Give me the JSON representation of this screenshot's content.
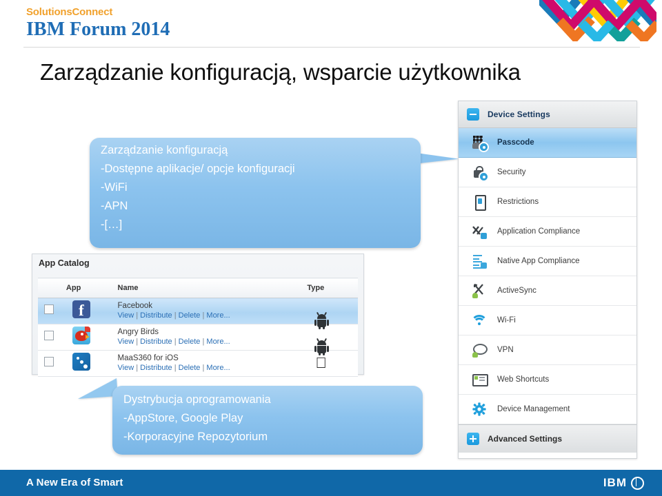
{
  "header": {
    "brand_top": "SolutionsConnect",
    "brand_main": "IBM Forum 2014",
    "logo_name": "solutions-connect-chevron-logo",
    "colors": {
      "brand_top": "#f1a12c",
      "brand_main": "#1f6db5",
      "logo_magenta": "#cf0a6b",
      "logo_cyan": "#29b9e7",
      "logo_blue": "#1a7bb9",
      "logo_teal": "#12a09a",
      "logo_yellow": "#ffcb05",
      "logo_orange": "#ef7622"
    }
  },
  "title": "Zarządzanie konfiguracją, wsparcie użytkownika",
  "callouts": {
    "configuration": {
      "name": "configuration-callout",
      "text": "Zarządzanie konfiguracją\n-Dostępne aplikacje/ opcje konfiguracji\n-WiFi\n-APN\n-[…]"
    },
    "distribution": {
      "name": "software-distribution-callout",
      "text": "Dystrybucja oprogramowania\n-AppStore, Google Play\n-Korporacyjne Repozytorium"
    },
    "bubble_color": "#8cc3ee"
  },
  "app_catalog": {
    "panel_title": "App Catalog",
    "columns": [
      "",
      "App",
      "Name",
      "Type"
    ],
    "rows": [
      {
        "checked": false,
        "icon": "facebook-icon",
        "icon_glyph": "f",
        "name": "Facebook",
        "actions": [
          "View",
          "Distribute",
          "Delete",
          "More..."
        ],
        "type": "android",
        "selected": true
      },
      {
        "checked": false,
        "icon": "angry-birds-icon",
        "icon_glyph": "",
        "name": "Angry Birds",
        "actions": [
          "View",
          "Distribute",
          "Delete",
          "More..."
        ],
        "type": "android",
        "selected": false
      },
      {
        "checked": false,
        "icon": "maas360-icon",
        "icon_glyph": "",
        "name": "MaaS360 for iOS",
        "actions": [
          "View",
          "Distribute",
          "Delete",
          "More..."
        ],
        "type": "apple",
        "selected": false
      }
    ],
    "link_color": "#2b6fb5",
    "selected_row_color": "#aed5f3"
  },
  "device_settings": {
    "header_label": "Device Settings",
    "header_icon": "collapse-minus-icon",
    "footer_label": "Advanced Settings",
    "footer_icon": "expand-plus-icon",
    "items": [
      {
        "label": "Passcode",
        "icon": "passcode-keypad-icon",
        "active": true
      },
      {
        "label": "Security",
        "icon": "security-lock-icon",
        "active": false
      },
      {
        "label": "Restrictions",
        "icon": "restrictions-phone-lock-icon",
        "active": false
      },
      {
        "label": "Application Compliance",
        "icon": "application-compliance-icon",
        "active": false
      },
      {
        "label": "Native App Compliance",
        "icon": "native-app-compliance-icon",
        "active": false
      },
      {
        "label": "ActiveSync",
        "icon": "activesync-icon",
        "active": false
      },
      {
        "label": "Wi-Fi",
        "icon": "wifi-icon",
        "active": false
      },
      {
        "label": "VPN",
        "icon": "vpn-icon",
        "active": false
      },
      {
        "label": "Web Shortcuts",
        "icon": "web-shortcuts-icon",
        "active": false
      },
      {
        "label": "Device Management",
        "icon": "device-management-gear-icon",
        "active": false
      }
    ],
    "active_color": "#8cc6ef",
    "header_text_color": "#17385e"
  },
  "footer": {
    "tagline": "A New Era of Smart",
    "logo_text": "IBM",
    "logo_mark": "ibm-globe-icon",
    "background": "#1068a8"
  }
}
